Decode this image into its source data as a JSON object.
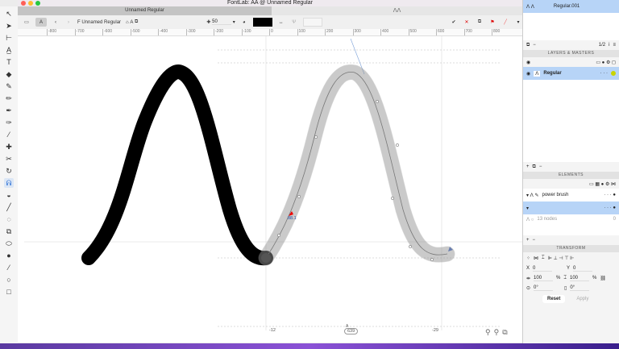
{
  "window": {
    "title": "FontLab: AA @ Unnamed Regular",
    "tab": "Unnamed Regular"
  },
  "toolbar": {
    "font_name": "Unnamed Regular",
    "glyph_label": "A",
    "zoom_value": "50"
  },
  "ruler": {
    "ticks": [
      "-800",
      "-700",
      "-600",
      "-500",
      "-400",
      "-300",
      "-200",
      "-100",
      "0",
      "100",
      "200",
      "300",
      "400",
      "500",
      "600",
      "700",
      "800"
    ]
  },
  "canvas": {
    "node_label": "88.1",
    "left_sb": "-12",
    "width": "639",
    "right_sb": "-29",
    "glyph_mark": "A"
  },
  "panel": {
    "glyph_tab": "Regular.001",
    "master_count": "1/2",
    "layers_header": "LAYERS & MASTERS",
    "layer_name": "Regular",
    "layer_color": "#c9d400",
    "elements_header": "ELEMENTS",
    "element_name": "power brush",
    "nodes_label": "13 nodes",
    "nodes_value": "0",
    "transform_header": "TRANSFORM",
    "x_label": "X",
    "x_value": "0",
    "y_label": "Y",
    "y_value": "0",
    "scale_x": "100",
    "scale_y": "100",
    "pct": "%",
    "rotate": "0°",
    "slant": "0°",
    "reset": "Reset",
    "apply": "Apply"
  }
}
